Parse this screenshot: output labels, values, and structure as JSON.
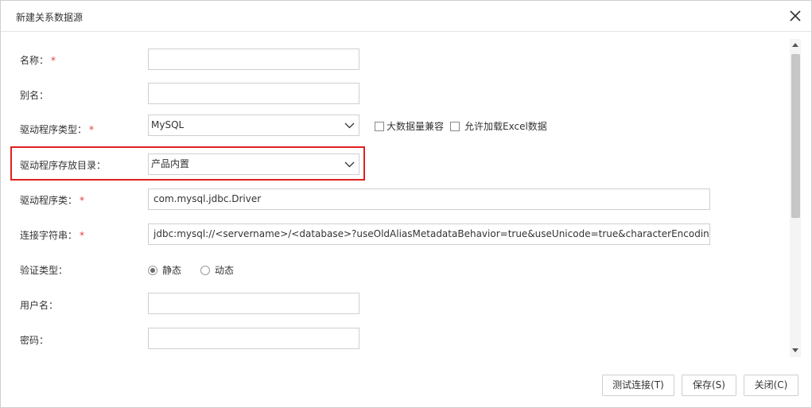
{
  "dialog": {
    "title": "新建关系数据源",
    "close_icon": "close-icon"
  },
  "form": {
    "name": {
      "label": "名称：",
      "required_mark": "*",
      "value": ""
    },
    "alias": {
      "label": "别名：",
      "value": ""
    },
    "driver_type": {
      "label": "驱动程序类型：",
      "required_mark": "*",
      "value": "MySQL",
      "bigdata_compat_label": "大数据量兼容",
      "bigdata_compat_checked": false,
      "allow_excel_label": "允许加载Excel数据",
      "allow_excel_checked": false
    },
    "driver_dir": {
      "label": "驱动程序存放目录：",
      "value": "产品内置",
      "highlighted": true
    },
    "driver_class": {
      "label": "驱动程序类：",
      "required_mark": "*",
      "value": "com.mysql.jdbc.Driver"
    },
    "connection_string": {
      "label": "连接字符串：",
      "required_mark": "*",
      "value": "jdbc:mysql://<servername>/<database>?useOldAliasMetadataBehavior=true&useUnicode=true&characterEncoding=GBK"
    },
    "auth_type": {
      "label": "验证类型：",
      "options": [
        "静态",
        "动态"
      ],
      "selected": "静态"
    },
    "username": {
      "label": "用户名：",
      "value": ""
    },
    "password": {
      "label": "密码：",
      "value": ""
    }
  },
  "footer": {
    "test_label": "测试连接(T)",
    "save_label": "保存(S)",
    "close_label": "关闭(C)"
  },
  "colors": {
    "required": "#e03b3b",
    "highlight_border": "#e02020",
    "border": "#cfcfcf"
  }
}
